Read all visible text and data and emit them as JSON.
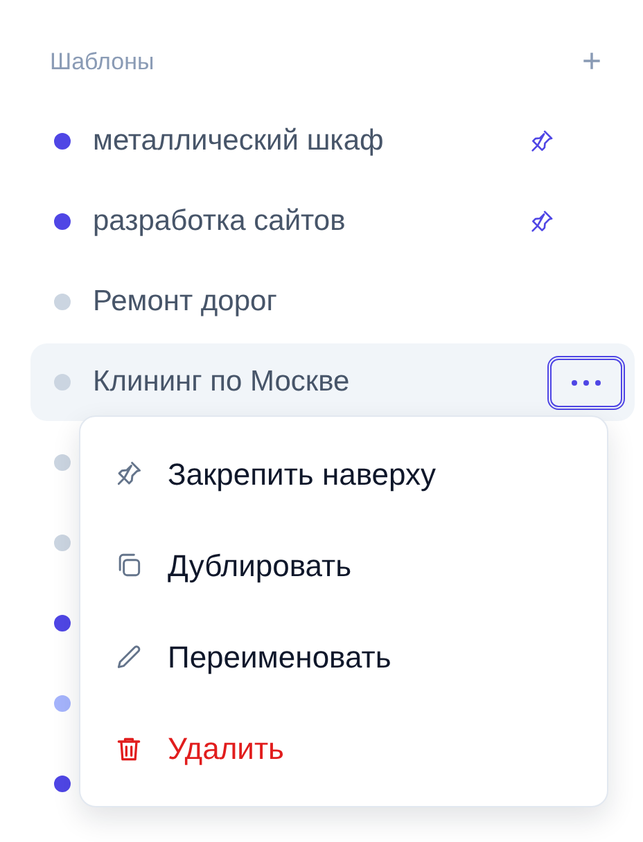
{
  "section": {
    "title": "Шаблоны",
    "add_button": "+"
  },
  "templates": [
    {
      "label": "металлический шкаф",
      "color": "#4f46e5",
      "pinned": true,
      "selected": false
    },
    {
      "label": "разработка сайтов",
      "color": "#4f46e5",
      "pinned": true,
      "selected": false
    },
    {
      "label": "Ремонт дорог",
      "color": "#cbd5e1",
      "pinned": false,
      "selected": false
    },
    {
      "label": "Клининг по Москве",
      "color": "#cbd5e1",
      "pinned": false,
      "selected": true
    },
    {
      "color": "#cbd5e1",
      "selected": false
    },
    {
      "color": "#cbd5e1",
      "selected": false
    },
    {
      "color": "#4f46e5",
      "selected": false
    },
    {
      "color": "#a5b4fc",
      "selected": false
    },
    {
      "color": "#4f46e5",
      "selected": false
    }
  ],
  "context_menu": [
    {
      "kind": "pin",
      "label": "Закрепить наверху"
    },
    {
      "kind": "duplicate",
      "label": "Дублировать"
    },
    {
      "kind": "rename",
      "label": "Переименовать"
    },
    {
      "kind": "delete",
      "label": "Удалить"
    }
  ]
}
